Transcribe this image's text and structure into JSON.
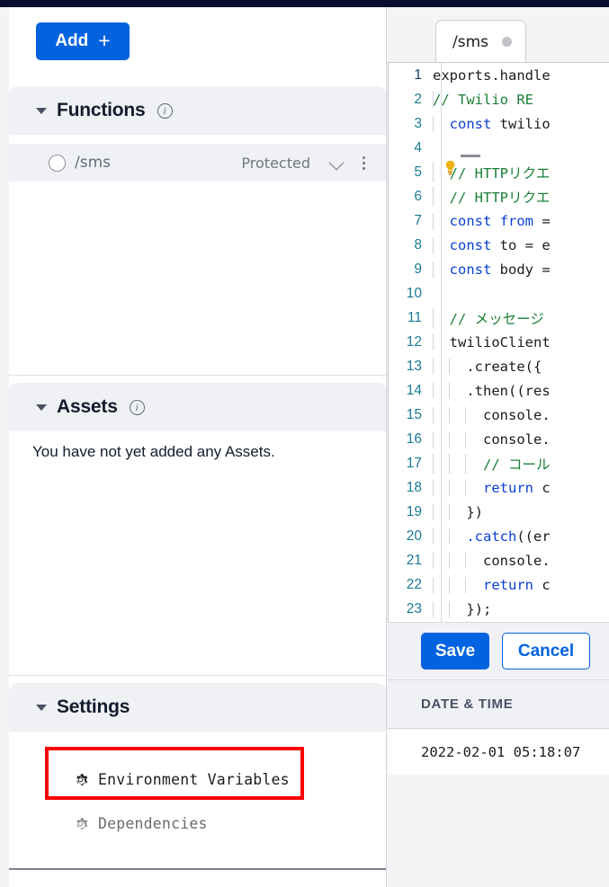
{
  "theme": {
    "topbar_color": "#0a0e2e",
    "accent_blue": "#0263e0",
    "panel_gray": "#f0f1f4",
    "highlight_red": "#ff0000",
    "comment_green": "#1a7f37",
    "keyword_blue": "#0b41cd",
    "linenum_teal": "#1a7b94"
  },
  "sidebar": {
    "add_button": {
      "label": "Add",
      "plus_glyph": "+"
    },
    "sections": [
      {
        "id": "functions",
        "title": "Functions",
        "info_glyph": "i",
        "caret_glyph": "▼",
        "items": [
          {
            "path": "/sms",
            "visibility": "Protected",
            "radio": "radio-unselected",
            "chevron": "chevron-down-icon",
            "kebab": "more-options-icon"
          }
        ]
      },
      {
        "id": "assets",
        "title": "Assets",
        "info_glyph": "i",
        "caret_glyph": "▼",
        "empty_message": "You have not yet added any Assets."
      },
      {
        "id": "settings",
        "title": "Settings",
        "caret_glyph": "▼",
        "items": [
          {
            "label": "Environment Variables",
            "icon": "gear-icon",
            "highlighted": true
          },
          {
            "label": "Dependencies",
            "icon": "gear-icon",
            "highlighted": false
          }
        ]
      }
    ]
  },
  "editor": {
    "tab": {
      "label": "/sms",
      "dirty_indicator": "unsaved-dot"
    },
    "lines": [
      {
        "n": "1",
        "segments": [
          {
            "t": "exports.handle",
            "c": "plain"
          }
        ]
      },
      {
        "n": "2",
        "segments": [
          {
            "t": "// Twilio RE",
            "c": "cmt"
          }
        ],
        "bulb": true
      },
      {
        "n": "3",
        "segments": [
          {
            "t": "  ",
            "c": "plain"
          },
          {
            "t": "const",
            "c": "kw"
          },
          {
            "t": " twilio",
            "c": "plain"
          }
        ]
      },
      {
        "n": "4",
        "segments": []
      },
      {
        "n": "5",
        "segments": [
          {
            "t": "  ",
            "c": "plain"
          },
          {
            "t": "// HTTPリクエ",
            "c": "cmt"
          }
        ]
      },
      {
        "n": "6",
        "segments": [
          {
            "t": "  ",
            "c": "plain"
          },
          {
            "t": "// HTTPリクエ",
            "c": "cmt"
          }
        ]
      },
      {
        "n": "7",
        "segments": [
          {
            "t": "  ",
            "c": "plain"
          },
          {
            "t": "const",
            "c": "kw"
          },
          {
            "t": " ",
            "c": "plain"
          },
          {
            "t": "from",
            "c": "kw"
          },
          {
            "t": " =",
            "c": "plain"
          }
        ]
      },
      {
        "n": "8",
        "segments": [
          {
            "t": "  ",
            "c": "plain"
          },
          {
            "t": "const",
            "c": "kw"
          },
          {
            "t": " to = e",
            "c": "plain"
          }
        ]
      },
      {
        "n": "9",
        "segments": [
          {
            "t": "  ",
            "c": "plain"
          },
          {
            "t": "const",
            "c": "kw"
          },
          {
            "t": " body =",
            "c": "plain"
          }
        ]
      },
      {
        "n": "10",
        "segments": []
      },
      {
        "n": "11",
        "segments": [
          {
            "t": "  ",
            "c": "plain"
          },
          {
            "t": "// メッセージ",
            "c": "cmt"
          }
        ]
      },
      {
        "n": "12",
        "segments": [
          {
            "t": "  twilioClient",
            "c": "plain"
          }
        ]
      },
      {
        "n": "13",
        "segments": [
          {
            "t": "    .create({",
            "c": "plain"
          }
        ]
      },
      {
        "n": "14",
        "segments": [
          {
            "t": "    .then((res",
            "c": "plain"
          }
        ]
      },
      {
        "n": "15",
        "segments": [
          {
            "t": "      console.",
            "c": "plain"
          }
        ]
      },
      {
        "n": "16",
        "segments": [
          {
            "t": "      console.",
            "c": "plain"
          }
        ]
      },
      {
        "n": "17",
        "segments": [
          {
            "t": "      ",
            "c": "plain"
          },
          {
            "t": "// コール",
            "c": "cmt"
          }
        ]
      },
      {
        "n": "18",
        "segments": [
          {
            "t": "      ",
            "c": "plain"
          },
          {
            "t": "return",
            "c": "kw"
          },
          {
            "t": " c",
            "c": "plain"
          }
        ]
      },
      {
        "n": "19",
        "segments": [
          {
            "t": "    })",
            "c": "plain"
          }
        ]
      },
      {
        "n": "20",
        "segments": [
          {
            "t": "    ",
            "c": "plain"
          },
          {
            "t": ".catch",
            "c": "fn"
          },
          {
            "t": "((er",
            "c": "plain"
          }
        ]
      },
      {
        "n": "21",
        "segments": [
          {
            "t": "      console.",
            "c": "plain"
          }
        ]
      },
      {
        "n": "22",
        "segments": [
          {
            "t": "      ",
            "c": "plain"
          },
          {
            "t": "return",
            "c": "kw"
          },
          {
            "t": " c",
            "c": "plain"
          }
        ]
      },
      {
        "n": "23",
        "segments": [
          {
            "t": "    });",
            "c": "plain"
          }
        ]
      }
    ],
    "actions": {
      "save_label": "Save",
      "cancel_label": "Cancel"
    }
  },
  "logs": {
    "columns": [
      "DATE & TIME"
    ],
    "rows": [
      {
        "timestamp": "2022-02-01 05:18:07"
      }
    ]
  }
}
